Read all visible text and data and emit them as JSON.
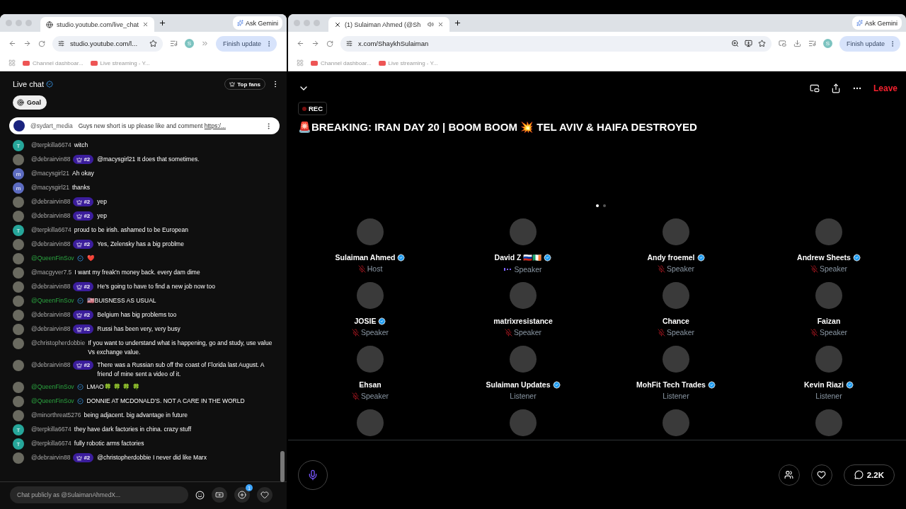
{
  "left_window": {
    "tab_title": "studio.youtube.com/live_chat",
    "url": "studio.youtube.com/l...",
    "ask_button": "Ask Gemini",
    "update_button": "Finish update",
    "profile_letter": "S",
    "bookmarks": [
      "Channel dashboar...",
      "Live streaming - Y..."
    ]
  },
  "chat": {
    "title": "Live chat",
    "top_fans": "Top fans",
    "goal": "Goal",
    "pinned": {
      "author": "@sydart_media",
      "text": "Guys new short is up please like and comment ",
      "link": "https:/..."
    },
    "messages": [
      {
        "author": "@terpkilla6674",
        "text": "witch",
        "kind": "letter",
        "letter": "T",
        "color": "#26a69a",
        "starred": false
      },
      {
        "author": "@debrairvin88",
        "rank": "#2",
        "text": "@macysgirl21 It does that sometimes.",
        "kind": "photo",
        "starred": false
      },
      {
        "author": "@macysgirl21",
        "text": "Ah okay",
        "kind": "letter",
        "letter": "m",
        "color": "#5c6bc0",
        "starred": false
      },
      {
        "author": "@macysgirl21",
        "text": "thanks",
        "kind": "letter",
        "letter": "m",
        "color": "#5c6bc0",
        "starred": false
      },
      {
        "author": "@debrairvin88",
        "rank": "#2",
        "text": "yep",
        "kind": "photo",
        "starred": false
      },
      {
        "author": "@debrairvin88",
        "rank": "#2",
        "text": "yep",
        "kind": "photo",
        "starred": false
      },
      {
        "author": "@terpkilla6674",
        "text": "proud to be irish. ashamed to be European",
        "kind": "letter",
        "letter": "T",
        "color": "#26a69a",
        "starred": false
      },
      {
        "author": "@debrairvin88",
        "rank": "#2",
        "text": "Yes, Zelensky has a big problme",
        "kind": "photo",
        "starred": false
      },
      {
        "author": "@QueenFinSov",
        "text": "❤️",
        "kind": "photo",
        "starred": true
      },
      {
        "author": "@macgyver7.5",
        "text": "I want my freak'n money back. every dam dime",
        "kind": "photo",
        "starred": false
      },
      {
        "author": "@debrairvin88",
        "rank": "#2",
        "text": "He's going to have to find a new job now too",
        "kind": "photo",
        "starred": false
      },
      {
        "author": "@QueenFinSov",
        "text": "🇺🇸BUISNESS AS USUAL",
        "kind": "photo",
        "starred": true
      },
      {
        "author": "@debrairvin88",
        "rank": "#2",
        "text": "Belgium has big problems too",
        "kind": "photo",
        "starred": false
      },
      {
        "author": "@debrairvin88",
        "rank": "#2",
        "text": "Russi has been very, very busy",
        "kind": "photo",
        "starred": false
      },
      {
        "author": "@christopherdobbie",
        "text": "If you want to understand what is happening, go and study, use value Vs exchange value.",
        "kind": "photo",
        "starred": false
      },
      {
        "author": "@debrairvin88",
        "rank": "#2",
        "text": "There was a Russian sub off the coast of Florida last August. A friend of mine sent a video of it.",
        "kind": "photo",
        "starred": false
      },
      {
        "author": "@QueenFinSov",
        "text": "LMAO🍀 🍀 🍀 🍀",
        "kind": "photo",
        "starred": true
      },
      {
        "author": "@QueenFinSov",
        "text": "DONNIE AT MCDONALD'S. NOT A CARE IN THE WORLD",
        "kind": "photo",
        "starred": true
      },
      {
        "author": "@minorthreat5276",
        "text": "being adjacent. big advantage in future",
        "kind": "photo",
        "starred": false
      },
      {
        "author": "@terpkilla6674",
        "text": "they have dark factories in china. crazy stuff",
        "kind": "letter",
        "letter": "T",
        "color": "#26a69a",
        "starred": false
      },
      {
        "author": "@terpkilla6674",
        "text": "fully robotic arms factories",
        "kind": "letter",
        "letter": "T",
        "color": "#26a69a",
        "starred": false
      },
      {
        "author": "@debrairvin88",
        "rank": "#2",
        "text": "@christopherdobbie I never did like Marx",
        "kind": "photo",
        "starred": false
      }
    ],
    "input_placeholder": "Chat publicly as @SulaimanAhmedX...",
    "gift_count": "1"
  },
  "right_window": {
    "tab_title": "(1) Sulaiman Ahmed (@Sh",
    "url": "x.com/ShaykhSulaiman",
    "ask_button": "Ask Gemini",
    "update_button": "Finish update",
    "profile_letter": "S",
    "bookmarks": [
      "Channel dashboar...",
      "Live streaming - Y..."
    ]
  },
  "space": {
    "rec": "REC",
    "leave": "Leave",
    "title": "🚨BREAKING: IRAN DAY 20 | BOOM BOOM 💥 TEL AVIV & HAIFA DESTROYED",
    "pages": [
      {
        "selected": true
      },
      {
        "selected": false
      }
    ],
    "participants": [
      {
        "kind": "full",
        "name": "Sulaiman Ahmed",
        "verified": true,
        "role": "Host",
        "muted": true,
        "speaking": false
      },
      {
        "kind": "full",
        "name": "David Z 🇷🇺🇮🇪",
        "verified": true,
        "role": "Speaker",
        "muted": false,
        "speaking": true
      },
      {
        "kind": "full",
        "name": "Andy froemel",
        "verified": true,
        "role": "Speaker",
        "muted": true,
        "speaking": false
      },
      {
        "kind": "full",
        "name": "Andrew Sheets",
        "verified": true,
        "role": "Speaker",
        "muted": true,
        "speaking": false
      },
      {
        "kind": "full",
        "name": "JOSIE",
        "verified": true,
        "role": "Speaker",
        "muted": true,
        "speaking": false
      },
      {
        "kind": "full",
        "name": "matrixresistance",
        "verified": false,
        "role": "Speaker",
        "muted": true,
        "speaking": false
      },
      {
        "kind": "full",
        "name": "Chance",
        "verified": false,
        "role": "Speaker",
        "muted": true,
        "speaking": false
      },
      {
        "kind": "full",
        "name": "Faizan",
        "verified": false,
        "role": "Speaker",
        "muted": true,
        "speaking": false
      },
      {
        "kind": "full",
        "name": "Ehsan",
        "verified": false,
        "role": "Speaker",
        "muted": true,
        "speaking": false
      },
      {
        "kind": "full",
        "name": "Sulaiman Updates",
        "verified": true,
        "role": "Listener",
        "muted": false,
        "speaking": false
      },
      {
        "kind": "full",
        "name": "MohFit Tech Trades",
        "verified": true,
        "role": "Listener",
        "muted": false,
        "speaking": false
      },
      {
        "kind": "full",
        "name": "Kevin Riazi",
        "verified": true,
        "role": "Listener",
        "muted": false,
        "speaking": false
      },
      {
        "kind": "partial"
      },
      {
        "kind": "partial"
      },
      {
        "kind": "partial"
      },
      {
        "kind": "partial"
      }
    ],
    "comments_count": "2.2K"
  }
}
